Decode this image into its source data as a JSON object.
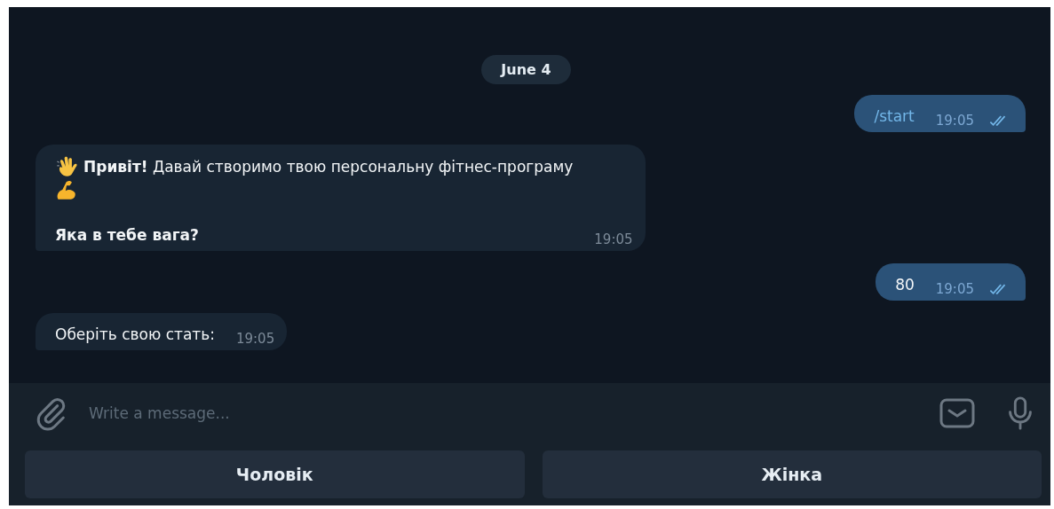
{
  "date_badge": "June 4",
  "messages": [
    {
      "outgoing": true,
      "kind": "plain",
      "paragraphs": [
        {
          "text": "/start",
          "bold": false
        }
      ],
      "time": "19:05",
      "read": true,
      "link": true
    },
    {
      "outgoing": false,
      "kind": "greeting",
      "paragraphs": [
        {
          "text": "**Привіт!** Давай створимо твою персональну фітнес-програму",
          "bold": false
        },
        {
          "text": "Яка в тебе вага?",
          "bold": true
        }
      ],
      "time": "19:05",
      "link": false
    },
    {
      "outgoing": true,
      "kind": "plain",
      "paragraphs": [
        {
          "text": "80",
          "bold": false
        }
      ],
      "time": "19:05",
      "read": true,
      "link": false
    },
    {
      "outgoing": false,
      "kind": "plain",
      "paragraphs": [
        {
          "text": "Оберіть свою стать:",
          "bold": false
        }
      ],
      "time": "19:05",
      "link": false
    }
  ],
  "composer": {
    "placeholder": "Write a message..."
  },
  "reply_buttons": [
    "Чоловік",
    "Жінка"
  ]
}
